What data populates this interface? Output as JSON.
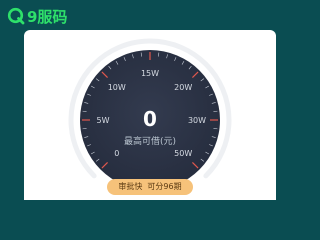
{
  "header": {
    "logo_text": "9服码",
    "logo_icon": "q-logo-icon"
  },
  "gauge": {
    "ticks": [
      {
        "label": "0"
      },
      {
        "label": "5W"
      },
      {
        "label": "10W"
      },
      {
        "label": "15W"
      },
      {
        "label": "20W"
      },
      {
        "label": "30W"
      },
      {
        "label": "50W"
      }
    ],
    "value_fraction": 0,
    "amount": "0",
    "caption": "最高可借(元)"
  },
  "cta": {
    "label_main": "审批快",
    "label_sub": "可分96期"
  },
  "colors": {
    "background": "#0a4d52",
    "gauge_face": "#2b3244",
    "accent_red": "#e0574d",
    "pill": "#f6c27a",
    "logo_green": "#2ee06a"
  }
}
